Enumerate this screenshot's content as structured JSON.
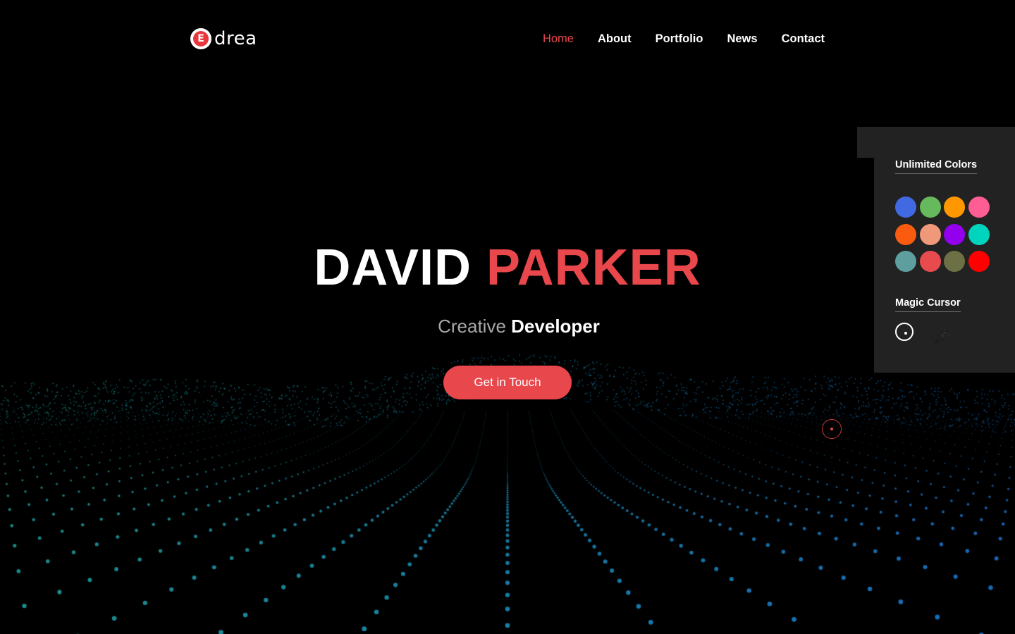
{
  "header": {
    "logo_mark": "E",
    "logo_text": "drea",
    "nav": [
      {
        "label": "Home",
        "active": true
      },
      {
        "label": "About",
        "active": false
      },
      {
        "label": "Portfolio",
        "active": false
      },
      {
        "label": "News",
        "active": false
      },
      {
        "label": "Contact",
        "active": false
      }
    ]
  },
  "hero": {
    "first_name": "DAVID",
    "last_name": "PARKER",
    "subtitle_light": "Creative",
    "subtitle_bold": "Developer",
    "cta_label": "Get in Touch"
  },
  "settings_panel": {
    "colors_heading": "Unlimited Colors",
    "swatches": [
      "#4169e1",
      "#66b95c",
      "#ff9800",
      "#ff5e94",
      "#fa5b0f",
      "#f0997a",
      "#9200ee",
      "#00d4bd",
      "#5e9e9f",
      "#e84b4e",
      "#6c7044",
      "#ff0000"
    ],
    "cursor_heading": "Magic Cursor",
    "cursor_options": [
      "circle-cursor-icon",
      "arrow-cursor-icon"
    ]
  },
  "colors": {
    "accent": "#e8474c",
    "background": "#000000",
    "panel": "#222222",
    "particles_left": "#1fa3a0",
    "particles_right": "#1976d2"
  }
}
